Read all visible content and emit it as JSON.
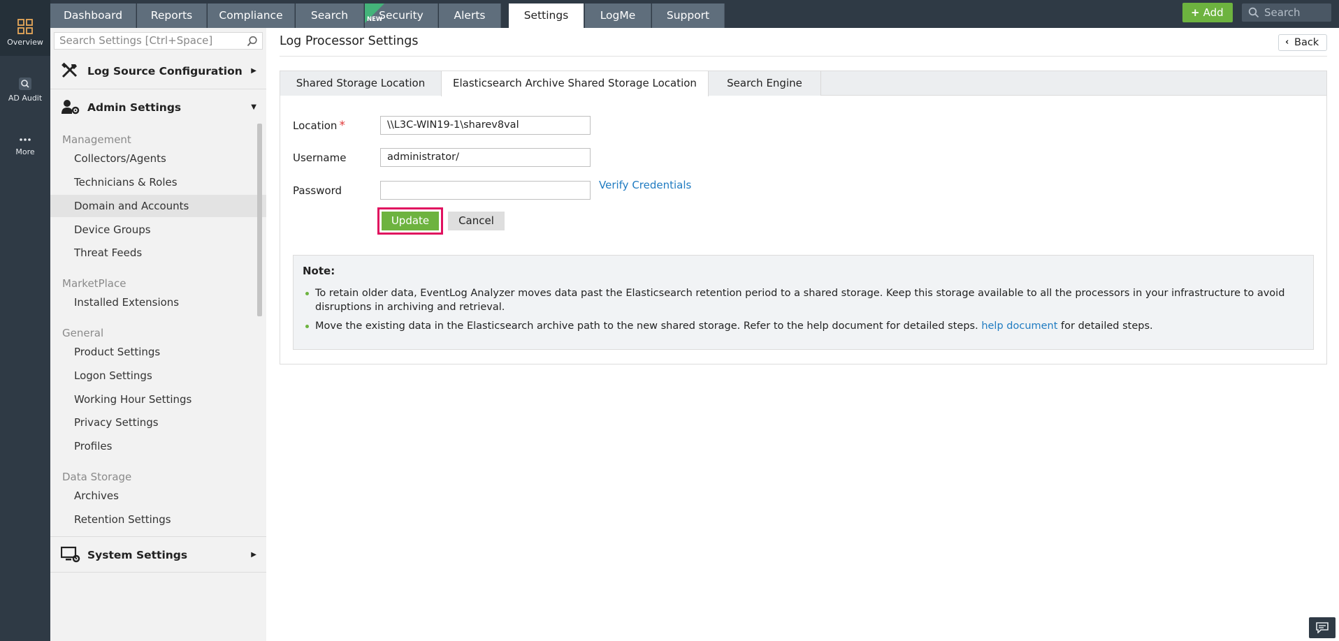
{
  "rail": {
    "overview_label": "Overview",
    "adaudit_label": "AD Audit",
    "more_label": "More"
  },
  "topnav": {
    "tabs": [
      {
        "label": "Dashboard"
      },
      {
        "label": "Reports"
      },
      {
        "label": "Compliance"
      },
      {
        "label": "Search"
      },
      {
        "label": "Security",
        "badge": "NEW"
      },
      {
        "label": "Alerts"
      },
      {
        "label": "Settings"
      },
      {
        "label": "LogMe"
      },
      {
        "label": "Support"
      }
    ],
    "active_tab": "Settings",
    "add_label": "Add",
    "search_placeholder": "Search"
  },
  "sidebar": {
    "search_placeholder": "Search Settings [Ctrl+Space]",
    "sections": {
      "log_source": "Log Source Configuration",
      "admin": "Admin Settings",
      "system": "System Settings"
    },
    "groups": {
      "management": "Management",
      "marketplace": "MarketPlace",
      "general": "General",
      "data_storage": "Data Storage"
    },
    "items": {
      "collectors": "Collectors/Agents",
      "technicians": "Technicians & Roles",
      "domain": "Domain and Accounts",
      "device_groups": "Device Groups",
      "threat_feeds": "Threat Feeds",
      "installed_ext": "Installed Extensions",
      "product_settings": "Product Settings",
      "logon_settings": "Logon Settings",
      "working_hour": "Working Hour Settings",
      "privacy": "Privacy Settings",
      "profiles": "Profiles",
      "archives": "Archives",
      "retention": "Retention Settings"
    },
    "selected_item": "Domain and Accounts"
  },
  "main": {
    "title": "Log Processor Settings",
    "back_label": "Back",
    "tabs": [
      {
        "label": "Shared Storage Location"
      },
      {
        "label": "Elasticsearch Archive Shared Storage Location"
      },
      {
        "label": "Search Engine"
      }
    ],
    "active_tab": "Elasticsearch Archive Shared Storage Location",
    "form": {
      "location_label": "Location",
      "required_mark": "*",
      "location_value": "\\\\L3C-WIN19-1\\sharev8val",
      "username_label": "Username",
      "username_value": "administrator/",
      "password_label": "Password",
      "password_value": "",
      "verify_label": "Verify Credentials",
      "update_label": "Update",
      "cancel_label": "Cancel"
    },
    "note": {
      "title": "Note:",
      "item1": "To retain older data, EventLog Analyzer moves data past the Elasticsearch retention period to a shared storage. Keep this storage available to all the processors in your infrastructure to avoid disruptions in archiving and retrieval.",
      "item2_prefix": "Move the existing data in the Elasticsearch archive path to the new shared storage. Refer to the help document for detailed steps.",
      "item2_link": "help document",
      "item2_suffix": "for detailed steps."
    }
  },
  "colors": {
    "accent_green": "#6db33f",
    "nav_dark": "#2f3a45",
    "tab_gray": "#5f6e7c",
    "link_blue": "#1f7bc1",
    "highlight_pink": "#e0115f"
  }
}
